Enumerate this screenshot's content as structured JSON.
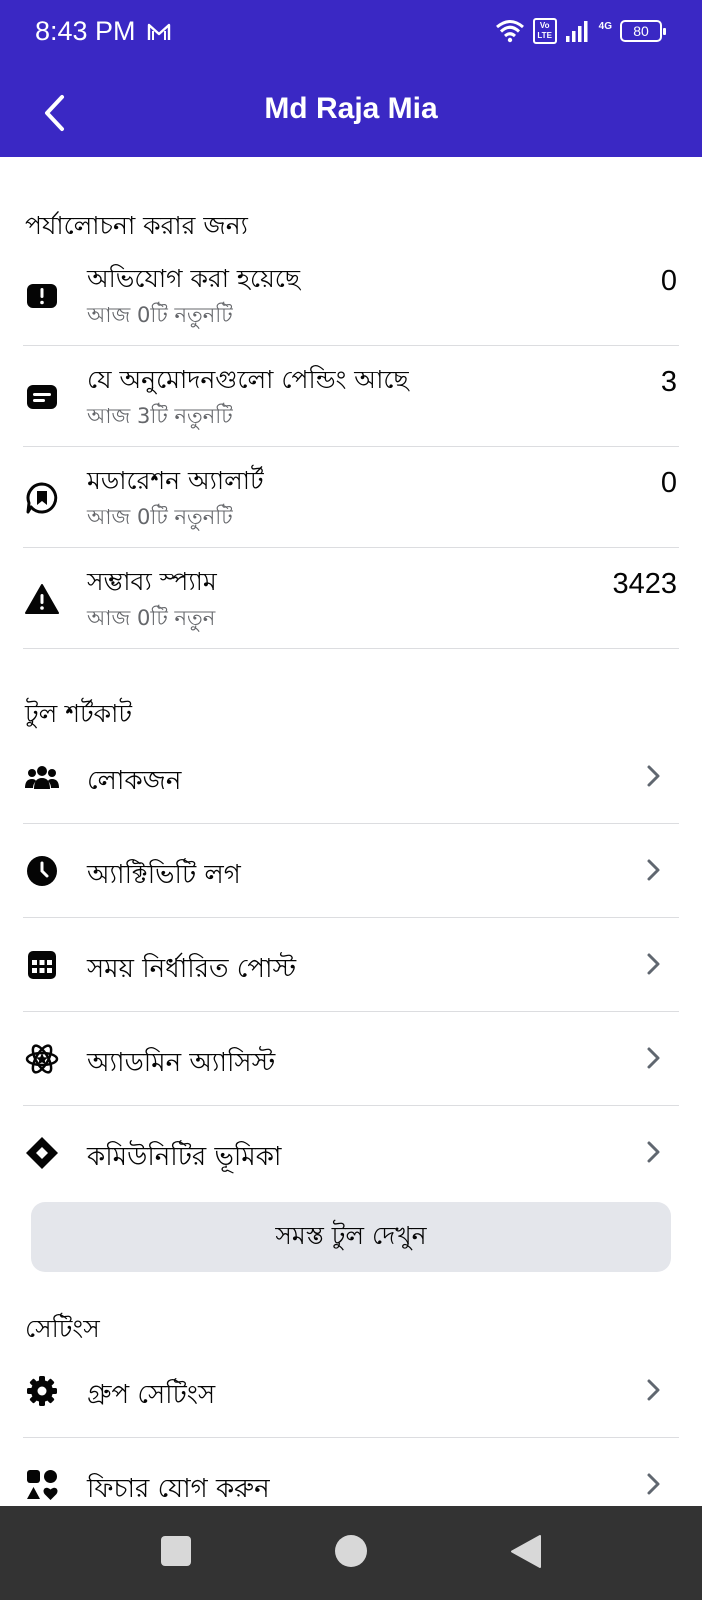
{
  "status_bar": {
    "time": "8:43 PM",
    "network": "4G",
    "volte": "Vo LTE",
    "battery": "80",
    "icons": [
      "mail-icon",
      "wifi-icon",
      "volte-icon",
      "signal-icon",
      "battery-icon"
    ]
  },
  "header": {
    "title": "Md Raja Mia",
    "back_icon": "back-arrow-icon"
  },
  "review": {
    "section_title": "পর্যালোচনা করার জন্য",
    "items": [
      {
        "title": "অভিযোগ করা হয়েছে",
        "subtitle": "আজ 0টি নতুনটি",
        "count": "0",
        "icon": "alert-icon"
      },
      {
        "title": "যে অনুমোদনগুলো পেন্ডিং আছে",
        "subtitle": "আজ 3টি নতুনটি",
        "count": "3",
        "icon": "pending-icon"
      },
      {
        "title": "মডারেশন অ্যালার্ট",
        "subtitle": "আজ 0টি নতুনটি",
        "count": "0",
        "icon": "moderation-alert-icon"
      },
      {
        "title": "সম্ভাব্য স্প্যাম",
        "subtitle": "আজ 0টি নতুন",
        "count": "3423",
        "icon": "warning-icon"
      }
    ]
  },
  "tools": {
    "section_title": "টুল শর্টকাট",
    "items": [
      {
        "label": "লোকজন",
        "icon": "people-icon"
      },
      {
        "label": "অ্যাক্টিভিটি লগ",
        "icon": "clock-icon"
      },
      {
        "label": "সময় নির্ধারিত পোস্ট",
        "icon": "calendar-icon"
      },
      {
        "label": "অ্যাডমিন অ্যাসিস্ট",
        "icon": "admin-assist-icon"
      },
      {
        "label": "কমিউনিটির ভূমিকা",
        "icon": "diamond-icon"
      }
    ],
    "all_tools_label": "সমস্ত টুল দেখুন"
  },
  "settings": {
    "section_title": "সেটিংস",
    "items": [
      {
        "label": "গ্রুপ সেটিংস",
        "icon": "gear-icon"
      },
      {
        "label": "ফিচার যোগ করুন",
        "icon": "add-features-icon"
      }
    ]
  },
  "nav": {
    "buttons": [
      "recent-apps-icon",
      "home-icon",
      "back-icon"
    ]
  },
  "colors": {
    "header_bg": "#3a28c4",
    "text_primary": "#050505",
    "text_secondary": "#65676b",
    "divider": "#dcdde0",
    "button_bg": "#e4e6eb",
    "nav_bg": "#333333"
  }
}
